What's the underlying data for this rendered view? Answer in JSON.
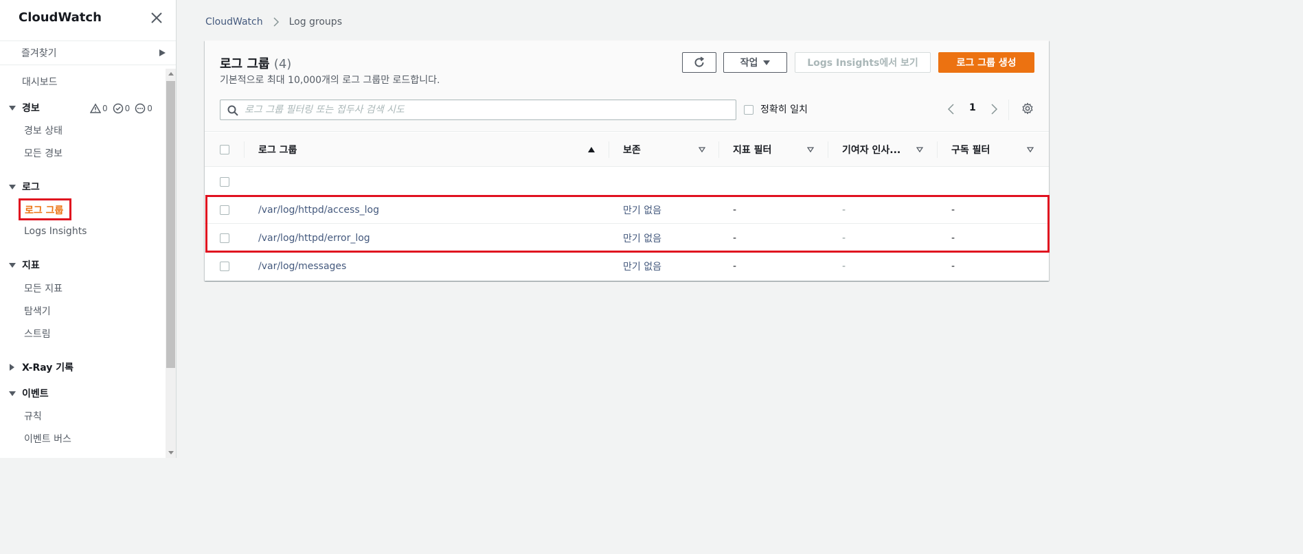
{
  "sidebar": {
    "title": "CloudWatch",
    "favorites": "즐겨찾기",
    "dashboard": "대시보드",
    "alarms": {
      "label": "경보",
      "counts": {
        "alarm": "0",
        "ok": "0",
        "insufficient": "0"
      },
      "items": [
        "경보 상태",
        "모든 경보"
      ]
    },
    "logs": {
      "label": "로그",
      "items": [
        "로그 그룹",
        "Logs Insights"
      ],
      "active": "로그 그룹"
    },
    "metrics": {
      "label": "지표",
      "items": [
        "모든 지표",
        "탐색기",
        "스트림"
      ]
    },
    "xray": {
      "label": "X-Ray 기록"
    },
    "events": {
      "label": "이벤트",
      "items": [
        "규칙",
        "이벤트 버스"
      ]
    }
  },
  "breadcrumb": {
    "root": "CloudWatch",
    "current": "Log groups"
  },
  "panel": {
    "title": "로그 그룹",
    "count": "(4)",
    "description": "기본적으로 최대 10,000개의 로그 그룹만 로드합니다.",
    "actions_label": "작업",
    "insights_label": "Logs Insights에서 보기",
    "create_label": "로그 그룹 생성",
    "search_placeholder": "로그 그룹 필터링 또는 접두사 검색 시도",
    "exact_match_label": "정확히 일치",
    "page": "1"
  },
  "table": {
    "columns": [
      "로그 그룹",
      "보존",
      "지표 필터",
      "기여자 인사...",
      "구독 필터"
    ],
    "rows": [
      {
        "name": "",
        "retention": "",
        "metric_filters": "",
        "contributor": "",
        "subscription": ""
      },
      {
        "name": "/var/log/httpd/access_log",
        "retention": "만기 없음",
        "metric_filters": "-",
        "contributor": "-",
        "subscription": "-"
      },
      {
        "name": "/var/log/httpd/error_log",
        "retention": "만기 없음",
        "metric_filters": "-",
        "contributor": "-",
        "subscription": "-"
      },
      {
        "name": "/var/log/messages",
        "retention": "만기 없음",
        "metric_filters": "-",
        "contributor": "-",
        "subscription": "-"
      }
    ]
  },
  "colors": {
    "accent": "#ec7211",
    "link": "#44597d",
    "highlight": "#e0111f"
  }
}
